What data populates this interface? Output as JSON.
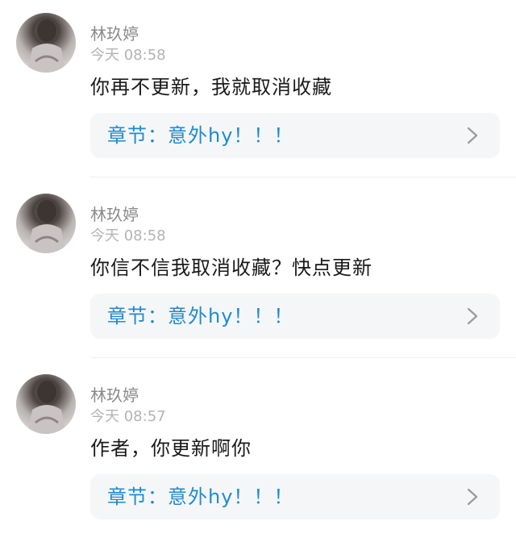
{
  "comments": [
    {
      "username": "林玖婷",
      "time": "今天 08:58",
      "content": "你再不更新，我就取消收藏",
      "chapter": "章节：意外hy！！！"
    },
    {
      "username": "林玖婷",
      "time": "今天 08:58",
      "content": "你信不信我取消收藏？快点更新",
      "chapter": "章节：意外hy！！！"
    },
    {
      "username": "林玖婷",
      "time": "今天 08:57",
      "content": "作者，你更新啊你",
      "chapter": "章节：意外hy！！！"
    }
  ],
  "icons": {
    "chapter_link": "chevron-right-icon",
    "avatar": "avatar"
  },
  "colors": {
    "username": "#8a8a8a",
    "time": "#b3b3b3",
    "content": "#1a1a1a",
    "chapter_link": "#1f8bd0",
    "card_background": "#f5f6f8"
  }
}
